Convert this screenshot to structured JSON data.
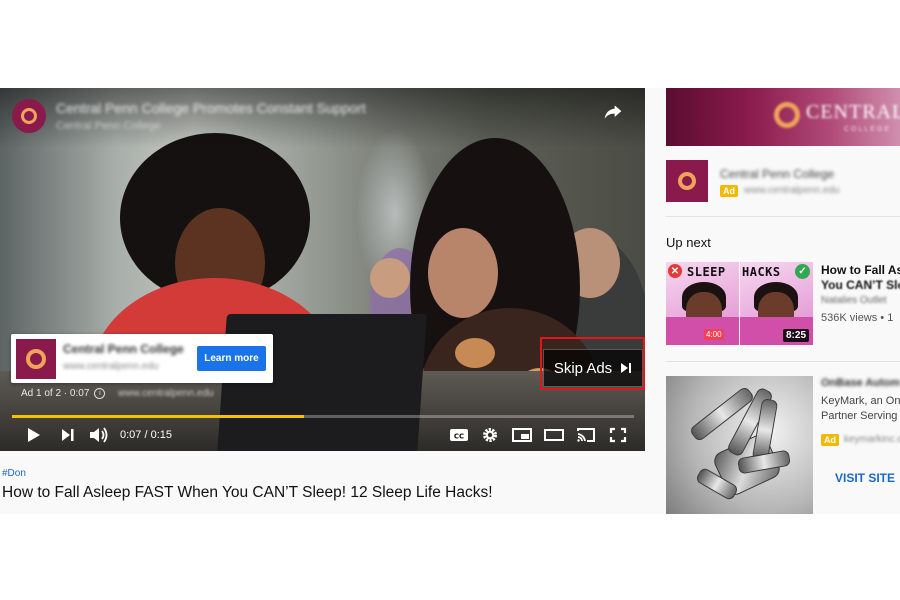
{
  "player": {
    "channel_title": "Central Penn College Promotes Constant Support",
    "channel_sub": "Central Penn College",
    "ad_card": {
      "name": "Central Penn College",
      "url": "www.centralpenn.edu",
      "cta": "Learn more"
    },
    "ad_counter": "Ad 1 of 2 · 0:07",
    "ad_domain": "www.centralpenn.edu",
    "skip_label": "Skip Ads",
    "time": "0:07 / 0:15",
    "progress": 0.47,
    "accent_color": "#f6c200",
    "highlight_color": "#e0161b"
  },
  "video": {
    "hashtag": "#Don",
    "title": "How to Fall Asleep FAST When You CAN’T Sleep! 12 Sleep Life Hacks!"
  },
  "sidebar": {
    "banner": {
      "text": "CENTRAL",
      "sub": "COLLEGE"
    },
    "ad": {
      "name": "Central Penn College",
      "badge": "Ad",
      "url": "www.centralpenn.edu"
    },
    "upnext_label": "Up next",
    "recommended": {
      "thumb_word1": "SLEEP",
      "thumb_word2": "HACKS",
      "thumb_bad": "✕",
      "thumb_good": "✓",
      "thumb_timer": "4:00",
      "duration": "8:25",
      "title_line1": "How to Fall As",
      "title_line2": "You CAN’T Sle",
      "channel": "Natalies Outlet",
      "views": "536K views • 1"
    },
    "ad2": {
      "title": "OnBase Autom",
      "line1": "KeyMark, an On",
      "line2": "Partner Serving",
      "badge": "Ad",
      "url": "keymarkinc.com",
      "cta": "VISIT SITE"
    }
  }
}
